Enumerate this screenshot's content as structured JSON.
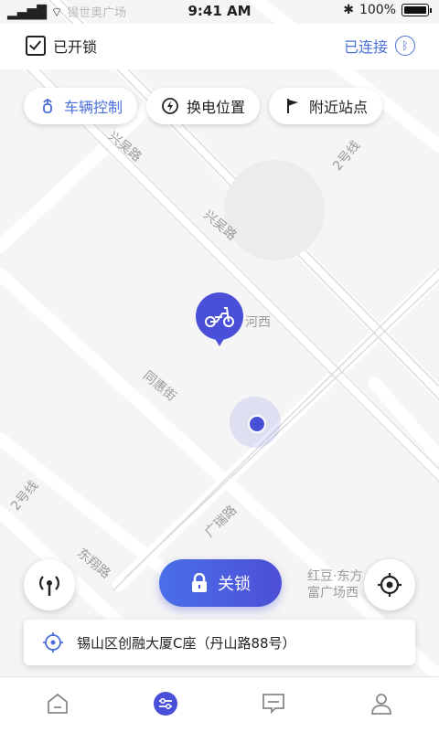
{
  "status_bar": {
    "time": "9:41 AM",
    "battery": "100%",
    "carrier_text": "锡世奥广场"
  },
  "header": {
    "lock_status": "已开锁",
    "connection": "已连接"
  },
  "chips": [
    {
      "label": "车辆控制",
      "icon": "scooter-control-icon",
      "active": true
    },
    {
      "label": "换电位置",
      "icon": "battery-swap-icon",
      "active": false
    },
    {
      "label": "附近站点",
      "icon": "flag-icon",
      "active": false
    }
  ],
  "map": {
    "labels": {
      "road_xingwu_1": "兴吴路",
      "road_xingwu_2": "兴吴路",
      "road_2hao": "2号线",
      "road_hexi": "河西",
      "road_tonghui": "同惠街",
      "road_guangrui": "广瑞路",
      "road_dongxiang": "东翔路",
      "road_2hao_left": "2号线",
      "poi_hongdou": "红豆·东方",
      "poi_hongdou_2": "富广场西"
    }
  },
  "actions": {
    "lock_button": "关锁"
  },
  "address": {
    "text": "锡山区创融大厦C座（丹山路88号）"
  },
  "tabs": [
    {
      "name": "home",
      "active": false
    },
    {
      "name": "control",
      "active": true
    },
    {
      "name": "messages",
      "active": false
    },
    {
      "name": "profile",
      "active": false
    }
  ],
  "colors": {
    "accent": "#4a6fd8",
    "marker": "#4a4fd8"
  }
}
